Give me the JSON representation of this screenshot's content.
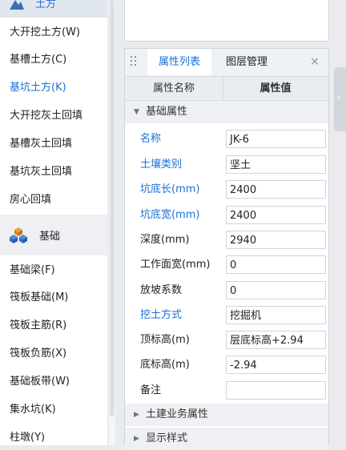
{
  "left_tree": {
    "top_category": {
      "label": "土方"
    },
    "items_top": [
      {
        "label": "大开挖土方(W)",
        "active": false
      },
      {
        "label": "基槽土方(C)",
        "active": false
      },
      {
        "label": "基坑土方(K)",
        "active": true
      },
      {
        "label": "大开挖灰土回填",
        "active": false
      },
      {
        "label": "基槽灰土回填",
        "active": false
      },
      {
        "label": "基坑灰土回填",
        "active": false
      },
      {
        "label": "房心回填",
        "active": false
      }
    ],
    "category": {
      "label": "基础"
    },
    "items_bottom": [
      {
        "label": "基础梁(F)"
      },
      {
        "label": "筏板基础(M)"
      },
      {
        "label": "筏板主筋(R)"
      },
      {
        "label": "筏板负筋(X)"
      },
      {
        "label": "基础板带(W)"
      },
      {
        "label": "集水坑(K)"
      },
      {
        "label": "柱墩(Y)"
      }
    ]
  },
  "properties_panel": {
    "tabs": [
      {
        "label": "属性列表",
        "active": true
      },
      {
        "label": "图层管理",
        "active": false
      }
    ],
    "close_glyph": "×",
    "columns": {
      "name": "属性名称",
      "value": "属性值"
    },
    "groups": {
      "basic": "基础属性",
      "civil": "土建业务属性",
      "display": "显示样式"
    },
    "rows": [
      {
        "name": "名称",
        "value": "JK-6",
        "blue": true
      },
      {
        "name": "土壤类别",
        "value": "坚土",
        "blue": true
      },
      {
        "name": "坑底长(mm)",
        "value": "2400",
        "blue": true
      },
      {
        "name": "坑底宽(mm)",
        "value": "2400",
        "blue": true
      },
      {
        "name": "深度(mm)",
        "value": "2940",
        "blue": false
      },
      {
        "name": "工作面宽(mm)",
        "value": "0",
        "blue": false
      },
      {
        "name": "放坡系数",
        "value": "0",
        "blue": false
      },
      {
        "name": "挖土方式",
        "value": "挖掘机",
        "blue": true
      },
      {
        "name": "顶标高(m)",
        "value": "层底标高+2.94",
        "blue": false
      },
      {
        "name": "底标高(m)",
        "value": "-2.94",
        "blue": false
      },
      {
        "name": "备注",
        "value": "",
        "blue": false
      }
    ]
  },
  "colors": {
    "accent": "#1a6fd8",
    "panel_bg": "#ffffff",
    "header_bg": "#e9edf2",
    "group_bg": "#eef0f3",
    "background": "#e9ebee"
  }
}
